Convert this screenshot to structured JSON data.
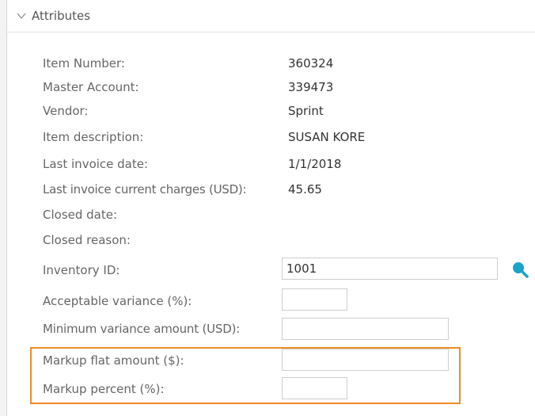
{
  "section": {
    "title": "Attributes"
  },
  "fields": {
    "item_number": {
      "label": "Item Number:",
      "value": "360324"
    },
    "master_account": {
      "label": "Master Account:",
      "value": "339473"
    },
    "vendor": {
      "label": "Vendor:",
      "value": "Sprint"
    },
    "item_description": {
      "label": "Item description:",
      "value": "SUSAN KORE"
    },
    "last_invoice_date": {
      "label": "Last invoice date:",
      "value": "1/1/2018"
    },
    "last_invoice_charges": {
      "label": "Last invoice current charges (USD):",
      "value": "45.65"
    },
    "closed_date": {
      "label": "Closed date:"
    },
    "closed_reason": {
      "label": "Closed reason:"
    },
    "inventory_id": {
      "label": "Inventory ID:",
      "value": "1001"
    },
    "acceptable_variance": {
      "label": "Acceptable variance (%):",
      "value": ""
    },
    "minimum_variance": {
      "label": "Minimum variance amount (USD):",
      "value": ""
    },
    "markup_flat": {
      "label": "Markup flat amount ($):",
      "value": ""
    },
    "markup_percent": {
      "label": "Markup percent (%):",
      "value": ""
    }
  },
  "icons": {
    "chevron": "chevron-down-icon",
    "search": "search-icon"
  },
  "colors": {
    "highlight": "#ee8a25",
    "search_icon": "#1aa3c9"
  }
}
